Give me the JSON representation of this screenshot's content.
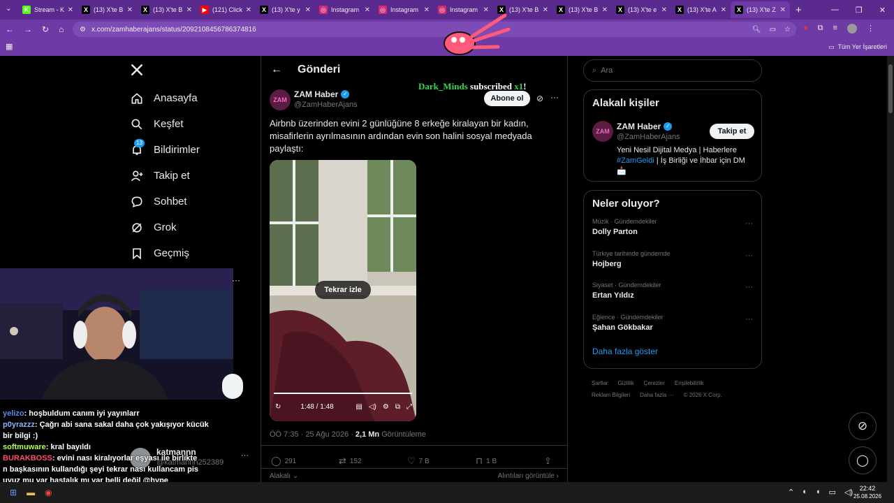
{
  "tabs": [
    {
      "title": "Stream - K",
      "fav": "K",
      "fav_color": "#53fc18"
    },
    {
      "title": "(13) X'te B",
      "fav": "X",
      "fav_color": "#000000"
    },
    {
      "title": "(13) X'te B",
      "fav": "X",
      "fav_color": "#000000"
    },
    {
      "title": "(121) Click",
      "fav": "▶",
      "fav_color": "#ff0000"
    },
    {
      "title": "(13) X'te y",
      "fav": "X",
      "fav_color": "#000000"
    },
    {
      "title": "Instagram",
      "fav": "◎",
      "fav_color": "#d62976"
    },
    {
      "title": "Instagram",
      "fav": "◎",
      "fav_color": "#d62976"
    },
    {
      "title": "Instagram",
      "fav": "◎",
      "fav_color": "#d62976"
    },
    {
      "title": "(13) X'te B",
      "fav": "X",
      "fav_color": "#000000"
    },
    {
      "title": "(13) X'te B",
      "fav": "X",
      "fav_color": "#000000"
    },
    {
      "title": "(13) X'te e",
      "fav": "X",
      "fav_color": "#000000"
    },
    {
      "title": "(13) X'te A",
      "fav": "X",
      "fav_color": "#000000"
    },
    {
      "title": "(13) X'te Z",
      "fav": "X",
      "fav_color": "#000000",
      "active": true
    }
  ],
  "address": {
    "url": "x.com/zamhaberajans/status/2092108456786374816"
  },
  "bookmarks": {
    "all_label": "Tüm Yer İşaretleri"
  },
  "nav": {
    "items": [
      {
        "label": "Anasayfa",
        "icon": "home-icon"
      },
      {
        "label": "Keşfet",
        "icon": "search-icon"
      },
      {
        "label": "Bildirimler",
        "icon": "bell-icon",
        "badge": "13"
      },
      {
        "label": "Takip et",
        "icon": "follow-icon"
      },
      {
        "label": "Sohbet",
        "icon": "chat-icon"
      },
      {
        "label": "Grok",
        "icon": "grok-icon"
      },
      {
        "label": "Geçmiş",
        "icon": "bookmark-icon"
      }
    ],
    "account": {
      "name": "katmannn",
      "handle": "@katmannn252389"
    }
  },
  "post": {
    "header": "Gönderi",
    "author": {
      "name": "ZAM Haber",
      "handle": "@ZamHaberAjans",
      "avatar_text": "ZAM"
    },
    "subscribe_label": "Abone ol",
    "text": "Airbnb üzerinden evini 2 günlüğüne 8 erkeğe kiralayan bir kadın, misafirlerin ayrılmasının ardından evin son halini sosyal medyada paylaştı:",
    "video": {
      "replay_label": "Tekrar izle",
      "time": "1:48 / 1:48",
      "progress": 1.0
    },
    "meta": {
      "time": "ÖÖ 7:35 · 25 Ağu 2026 ·",
      "views": "2,1 Mn",
      "views_label": "Görüntüleme"
    },
    "actions": {
      "replies": "291",
      "reposts": "152",
      "likes": "7 B",
      "bookmarks": "1 B"
    },
    "footer": {
      "related": "Alakalı",
      "quotes": "Alıntıları görüntüle"
    }
  },
  "overlay": {
    "sub_user": "Dark_Minds",
    "sub_text": "subscribed",
    "sub_count": "x1",
    "sub_suffix": "!"
  },
  "search": {
    "placeholder": "Ara"
  },
  "related": {
    "title": "Alakalı kişiler",
    "name": "ZAM Haber",
    "handle": "@ZamHaberAjans",
    "follow_label": "Takip et",
    "bio_1": "Yeni Nesil Dijital Medya | Haberlere",
    "hashtag": "#ZamGeldi",
    "bio_2": " | İş Birliği ve İhbar için DM",
    "bio_emoji": "📩"
  },
  "trends": {
    "title": "Neler oluyor?",
    "items": [
      {
        "category": "Müzik · Gündemdekiler",
        "name": "Dolly Parton"
      },
      {
        "category": "Türkiye tarihinde gündemde",
        "name": "Hojberg"
      },
      {
        "category": "Siyaset · Gündemdekiler",
        "name": "Ertan Yıldız"
      },
      {
        "category": "Eğlence · Gündemdekiler",
        "name": "Şahan Gökbakar"
      }
    ],
    "more": "Daha fazla göster"
  },
  "footer_links": {
    "line1": [
      "Şartlar",
      "Gizlilik",
      "Çerezler",
      "Erişilebilirlik"
    ],
    "line2": [
      "Reklam Bilgileri",
      "Daha fazla ···",
      "© 2026 X Corp."
    ]
  },
  "chat": [
    {
      "user": "yelizo",
      "color": "#5b8def",
      "msg": ": hoşbuldum canım iyi yayınlarr"
    },
    {
      "user": "p0yrazzz",
      "color": "#8fb2ff",
      "msg": ": Çağrı abi sana sakal daha çok yakışıyor kücük"
    },
    {
      "user": "",
      "color": "#ffffff",
      "msg": "bir bilgi :)"
    },
    {
      "user": "softmuware",
      "color": "#b6ff4a",
      "msg": ": kral bayıldı"
    },
    {
      "user": "BURAKBOSS",
      "color": "#ff4d6d",
      "msg": ": evini nası kiralıyorlar eşyası ile birlikte"
    },
    {
      "user": "",
      "color": "#ffffff",
      "msg": "n başkasının kullandığı şeyi tekrar nası kullancam pis"
    },
    {
      "user": "",
      "color": "#ffffff",
      "msg": "uyuz mu var hastalık mı var belli değil @hype"
    }
  ],
  "taskbar": {
    "time": "22:42",
    "date": "25.08.2026"
  },
  "colors": {
    "accent": "#1d9bf0",
    "chrome": "#6d3aa6",
    "chrome_dark": "#5b2a8f"
  }
}
